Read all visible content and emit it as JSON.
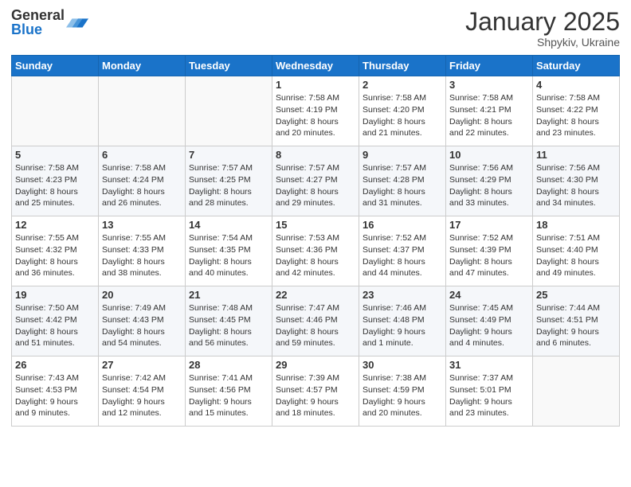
{
  "logo": {
    "general": "General",
    "blue": "Blue"
  },
  "title": "January 2025",
  "location": "Shpykiv, Ukraine",
  "days_header": [
    "Sunday",
    "Monday",
    "Tuesday",
    "Wednesday",
    "Thursday",
    "Friday",
    "Saturday"
  ],
  "weeks": [
    [
      {
        "day": "",
        "info": ""
      },
      {
        "day": "",
        "info": ""
      },
      {
        "day": "",
        "info": ""
      },
      {
        "day": "1",
        "info": "Sunrise: 7:58 AM\nSunset: 4:19 PM\nDaylight: 8 hours\nand 20 minutes."
      },
      {
        "day": "2",
        "info": "Sunrise: 7:58 AM\nSunset: 4:20 PM\nDaylight: 8 hours\nand 21 minutes."
      },
      {
        "day": "3",
        "info": "Sunrise: 7:58 AM\nSunset: 4:21 PM\nDaylight: 8 hours\nand 22 minutes."
      },
      {
        "day": "4",
        "info": "Sunrise: 7:58 AM\nSunset: 4:22 PM\nDaylight: 8 hours\nand 23 minutes."
      }
    ],
    [
      {
        "day": "5",
        "info": "Sunrise: 7:58 AM\nSunset: 4:23 PM\nDaylight: 8 hours\nand 25 minutes."
      },
      {
        "day": "6",
        "info": "Sunrise: 7:58 AM\nSunset: 4:24 PM\nDaylight: 8 hours\nand 26 minutes."
      },
      {
        "day": "7",
        "info": "Sunrise: 7:57 AM\nSunset: 4:25 PM\nDaylight: 8 hours\nand 28 minutes."
      },
      {
        "day": "8",
        "info": "Sunrise: 7:57 AM\nSunset: 4:27 PM\nDaylight: 8 hours\nand 29 minutes."
      },
      {
        "day": "9",
        "info": "Sunrise: 7:57 AM\nSunset: 4:28 PM\nDaylight: 8 hours\nand 31 minutes."
      },
      {
        "day": "10",
        "info": "Sunrise: 7:56 AM\nSunset: 4:29 PM\nDaylight: 8 hours\nand 33 minutes."
      },
      {
        "day": "11",
        "info": "Sunrise: 7:56 AM\nSunset: 4:30 PM\nDaylight: 8 hours\nand 34 minutes."
      }
    ],
    [
      {
        "day": "12",
        "info": "Sunrise: 7:55 AM\nSunset: 4:32 PM\nDaylight: 8 hours\nand 36 minutes."
      },
      {
        "day": "13",
        "info": "Sunrise: 7:55 AM\nSunset: 4:33 PM\nDaylight: 8 hours\nand 38 minutes."
      },
      {
        "day": "14",
        "info": "Sunrise: 7:54 AM\nSunset: 4:35 PM\nDaylight: 8 hours\nand 40 minutes."
      },
      {
        "day": "15",
        "info": "Sunrise: 7:53 AM\nSunset: 4:36 PM\nDaylight: 8 hours\nand 42 minutes."
      },
      {
        "day": "16",
        "info": "Sunrise: 7:52 AM\nSunset: 4:37 PM\nDaylight: 8 hours\nand 44 minutes."
      },
      {
        "day": "17",
        "info": "Sunrise: 7:52 AM\nSunset: 4:39 PM\nDaylight: 8 hours\nand 47 minutes."
      },
      {
        "day": "18",
        "info": "Sunrise: 7:51 AM\nSunset: 4:40 PM\nDaylight: 8 hours\nand 49 minutes."
      }
    ],
    [
      {
        "day": "19",
        "info": "Sunrise: 7:50 AM\nSunset: 4:42 PM\nDaylight: 8 hours\nand 51 minutes."
      },
      {
        "day": "20",
        "info": "Sunrise: 7:49 AM\nSunset: 4:43 PM\nDaylight: 8 hours\nand 54 minutes."
      },
      {
        "day": "21",
        "info": "Sunrise: 7:48 AM\nSunset: 4:45 PM\nDaylight: 8 hours\nand 56 minutes."
      },
      {
        "day": "22",
        "info": "Sunrise: 7:47 AM\nSunset: 4:46 PM\nDaylight: 8 hours\nand 59 minutes."
      },
      {
        "day": "23",
        "info": "Sunrise: 7:46 AM\nSunset: 4:48 PM\nDaylight: 9 hours\nand 1 minute."
      },
      {
        "day": "24",
        "info": "Sunrise: 7:45 AM\nSunset: 4:49 PM\nDaylight: 9 hours\nand 4 minutes."
      },
      {
        "day": "25",
        "info": "Sunrise: 7:44 AM\nSunset: 4:51 PM\nDaylight: 9 hours\nand 6 minutes."
      }
    ],
    [
      {
        "day": "26",
        "info": "Sunrise: 7:43 AM\nSunset: 4:53 PM\nDaylight: 9 hours\nand 9 minutes."
      },
      {
        "day": "27",
        "info": "Sunrise: 7:42 AM\nSunset: 4:54 PM\nDaylight: 9 hours\nand 12 minutes."
      },
      {
        "day": "28",
        "info": "Sunrise: 7:41 AM\nSunset: 4:56 PM\nDaylight: 9 hours\nand 15 minutes."
      },
      {
        "day": "29",
        "info": "Sunrise: 7:39 AM\nSunset: 4:57 PM\nDaylight: 9 hours\nand 18 minutes."
      },
      {
        "day": "30",
        "info": "Sunrise: 7:38 AM\nSunset: 4:59 PM\nDaylight: 9 hours\nand 20 minutes."
      },
      {
        "day": "31",
        "info": "Sunrise: 7:37 AM\nSunset: 5:01 PM\nDaylight: 9 hours\nand 23 minutes."
      },
      {
        "day": "",
        "info": ""
      }
    ]
  ]
}
